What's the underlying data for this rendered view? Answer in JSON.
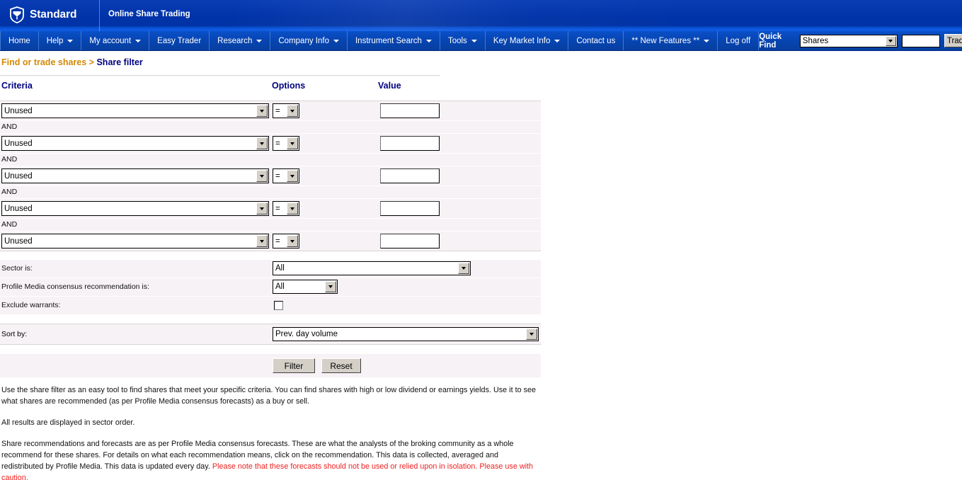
{
  "header": {
    "logo_text": "Standard",
    "logo_icon": "shield-icon",
    "subtitle": "Online Share Trading"
  },
  "nav": {
    "items": [
      {
        "label": "Home",
        "has_caret": false
      },
      {
        "label": "Help",
        "has_caret": true
      },
      {
        "label": "My account",
        "has_caret": true
      },
      {
        "label": "Easy Trader",
        "has_caret": false
      },
      {
        "label": "Research",
        "has_caret": true
      },
      {
        "label": "Company Info",
        "has_caret": true
      },
      {
        "label": "Instrument Search",
        "has_caret": true
      },
      {
        "label": "Tools",
        "has_caret": true
      },
      {
        "label": "Key Market Info",
        "has_caret": true
      },
      {
        "label": "Contact us",
        "has_caret": false
      },
      {
        "label": "** New Features **",
        "has_caret": true
      },
      {
        "label": "Log off",
        "has_caret": false
      }
    ],
    "quick_find": {
      "label": "Quick Find",
      "select_value": "Shares",
      "input_value": "",
      "button_label": "Trade"
    }
  },
  "breadcrumb": {
    "parent": "Find or trade shares",
    "separator": ">",
    "current": "Share filter"
  },
  "table": {
    "headers": {
      "criteria": "Criteria",
      "options": "Options",
      "value": "Value"
    },
    "conjunction": "AND",
    "rows": [
      {
        "criteria": "Unused",
        "operator": "=",
        "value": ""
      },
      {
        "criteria": "Unused",
        "operator": "=",
        "value": ""
      },
      {
        "criteria": "Unused",
        "operator": "=",
        "value": ""
      },
      {
        "criteria": "Unused",
        "operator": "=",
        "value": ""
      },
      {
        "criteria": "Unused",
        "operator": "=",
        "value": ""
      }
    ]
  },
  "options": {
    "sector": {
      "label": "Sector is:",
      "value": "All"
    },
    "recommendation": {
      "label": "Profile Media consensus recommendation is:",
      "value": "All"
    },
    "exclude_warrants": {
      "label": "Exclude warrants:",
      "checked": false
    }
  },
  "sort": {
    "label": "Sort by:",
    "value": "Prev. day volume"
  },
  "buttons": {
    "filter": "Filter",
    "reset": "Reset"
  },
  "help": {
    "para1": "Use the share filter as an easy tool to find shares that meet your specific criteria. You can find shares with high or low dividend or earnings yields. Use it to see what shares are recommended (as per Profile Media consensus forecasts) as a buy or sell.",
    "para2": "All results are displayed in sector order.",
    "para3_normal": "Share recommendations and forecasts are as per Profile Media consensus forecasts. These are what the analysts of the broking community as a whole recommend for these shares. For details on what each recommendation means, click on the recommendation. This data is collected, averaged and redistributed by Profile Media. This data is updated every day. ",
    "para3_warning": "Please note that these forecasts should not be used or relied upon in isolation. Please use with caution."
  },
  "colors": {
    "brand_blue": "#0033a0",
    "nav_blue": "#0645b0",
    "breadcrumb_parent": "#d48806",
    "breadcrumb_current": "#000080",
    "heading": "#000080",
    "row_bg": "#f7f2f5",
    "warning_red": "#ee2222"
  }
}
